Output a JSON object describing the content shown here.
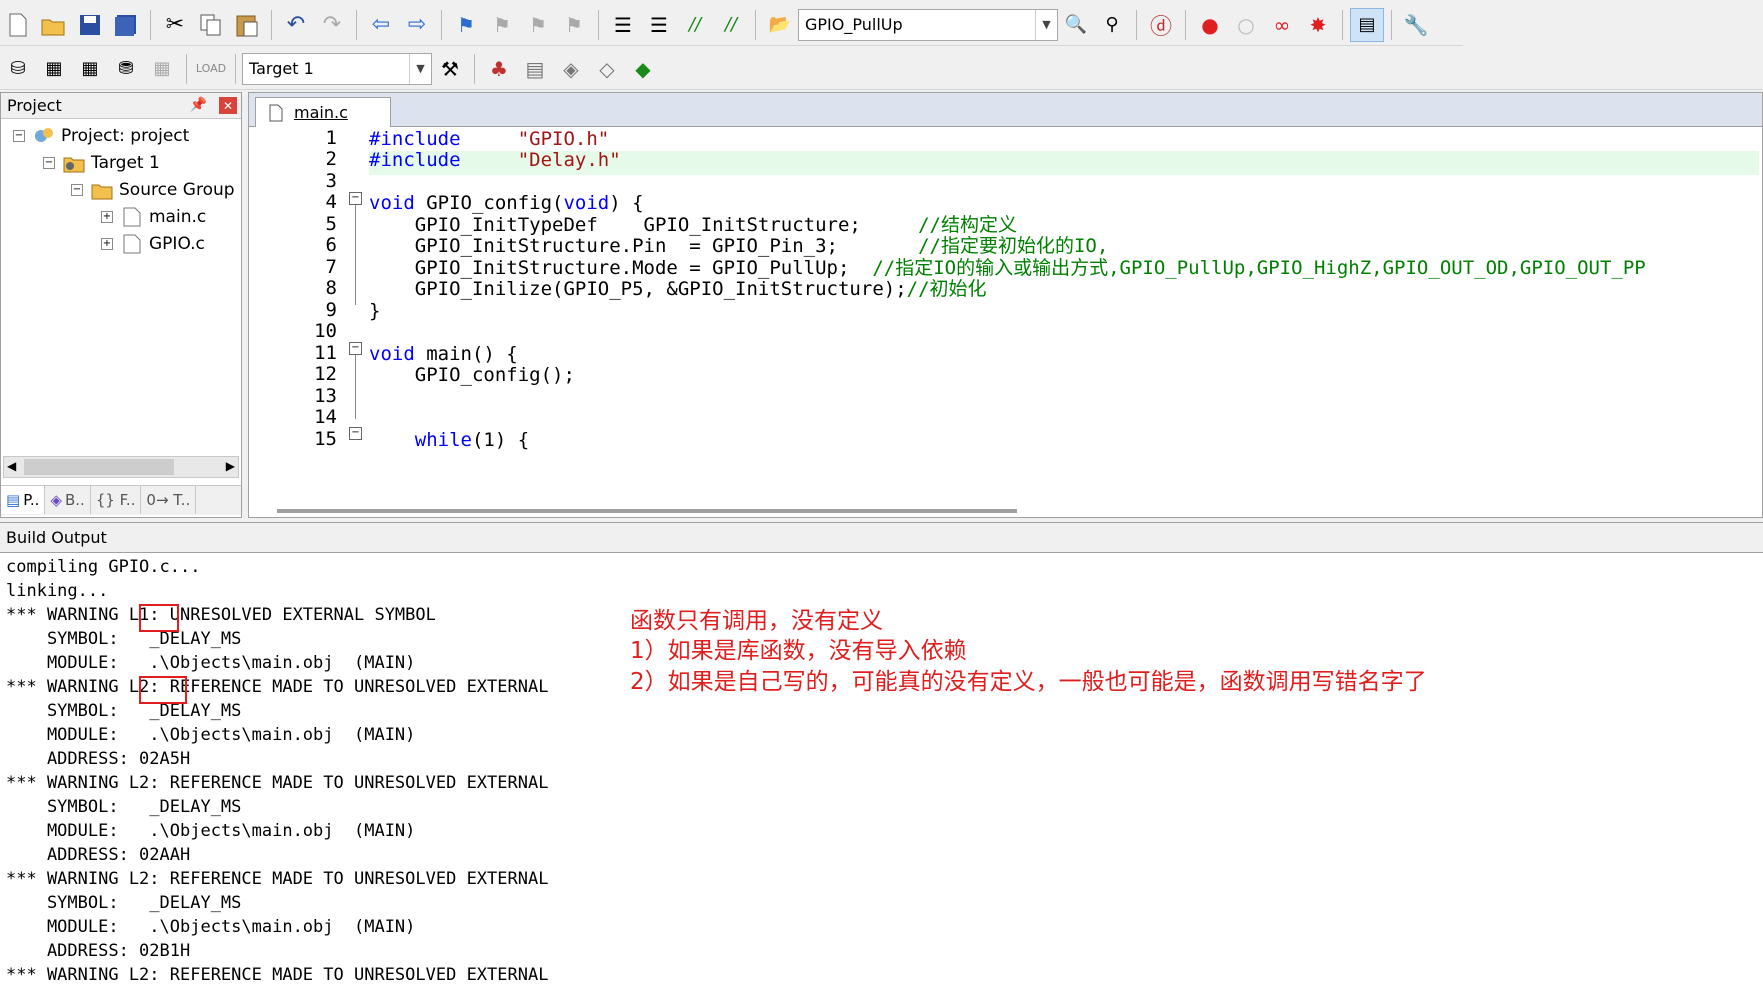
{
  "toolbar1": {
    "target_combo_value": "GPIO_PullUp"
  },
  "toolbar2": {
    "target_select_value": "Target 1"
  },
  "project": {
    "header": "Project",
    "tree": [
      {
        "label": "Project: project"
      },
      {
        "label": "Target 1"
      },
      {
        "label": "Source Group"
      },
      {
        "label": "main.c"
      },
      {
        "label": "GPIO.c"
      }
    ],
    "tabs": [
      "P..",
      "B..",
      "{} F..",
      "0→ T.."
    ]
  },
  "editor": {
    "tab": "main.c",
    "line_numbers": [
      "1",
      "2",
      "3",
      "4",
      "5",
      "6",
      "7",
      "8",
      "9",
      "10",
      "11",
      "12",
      "13",
      "14",
      "15"
    ],
    "lines": {
      "l1a": "#include",
      "l1b": "\"GPIO.h\"",
      "l2a": "#include",
      "l2b": "\"Delay.h\"",
      "l4a": "void",
      "l4b": " GPIO_config(",
      "l4c": "void",
      "l4d": ") {",
      "l5a": "    GPIO_InitTypeDef    GPIO_InitStructure;",
      "l5b": "//结构定义",
      "l6a": "    GPIO_InitStructure.Pin  = GPIO_Pin_3;",
      "l6b": "//指定要初始化的IO,",
      "l7a": "    GPIO_InitStructure.Mode = GPIO_PullUp;",
      "l7b": "//指定IO的输入或输出方式,GPIO_PullUp,GPIO_HighZ,GPIO_OUT_OD,GPIO_OUT_PP",
      "l8a": "    GPIO_Inilize(GPIO_P5, &GPIO_InitStructure);",
      "l8b": "//初始化",
      "l9": "}",
      "l11a": "void",
      "l11b": " main() {",
      "l12": "    GPIO_config();",
      "l15a": "    ",
      "l15b": "while",
      "l15c": "(1) {"
    }
  },
  "build": {
    "header": "Build Output",
    "lines": [
      "compiling GPIO.c...",
      "linking...",
      "*** WARNING L1: UNRESOLVED EXTERNAL SYMBOL",
      "    SYMBOL:   _DELAY_MS",
      "    MODULE:   .\\Objects\\main.obj  (MAIN)",
      "*** WARNING L2: REFERENCE MADE TO UNRESOLVED EXTERNAL",
      "    SYMBOL:   _DELAY_MS",
      "    MODULE:   .\\Objects\\main.obj  (MAIN)",
      "    ADDRESS: 02A5H",
      "*** WARNING L2: REFERENCE MADE TO UNRESOLVED EXTERNAL",
      "    SYMBOL:   _DELAY_MS",
      "    MODULE:   .\\Objects\\main.obj  (MAIN)",
      "    ADDRESS: 02AAH",
      "*** WARNING L2: REFERENCE MADE TO UNRESOLVED EXTERNAL",
      "    SYMBOL:   _DELAY_MS",
      "    MODULE:   .\\Objects\\main.obj  (MAIN)",
      "    ADDRESS: 02B1H",
      "*** WARNING L2: REFERENCE MADE TO UNRESOLVED EXTERNAL"
    ],
    "notes": [
      "函数只有调用，没有定义",
      "1）如果是库函数，没有导入依赖",
      "2）如果是自己写的，可能真的没有定义，一般也可能是，函数调用写错名字了"
    ]
  },
  "colors": {
    "keyword": "#0000ff",
    "string": "#a31515",
    "comment": "#008000",
    "annotation": "#e01e1e",
    "current_line": "#e6fae9"
  }
}
